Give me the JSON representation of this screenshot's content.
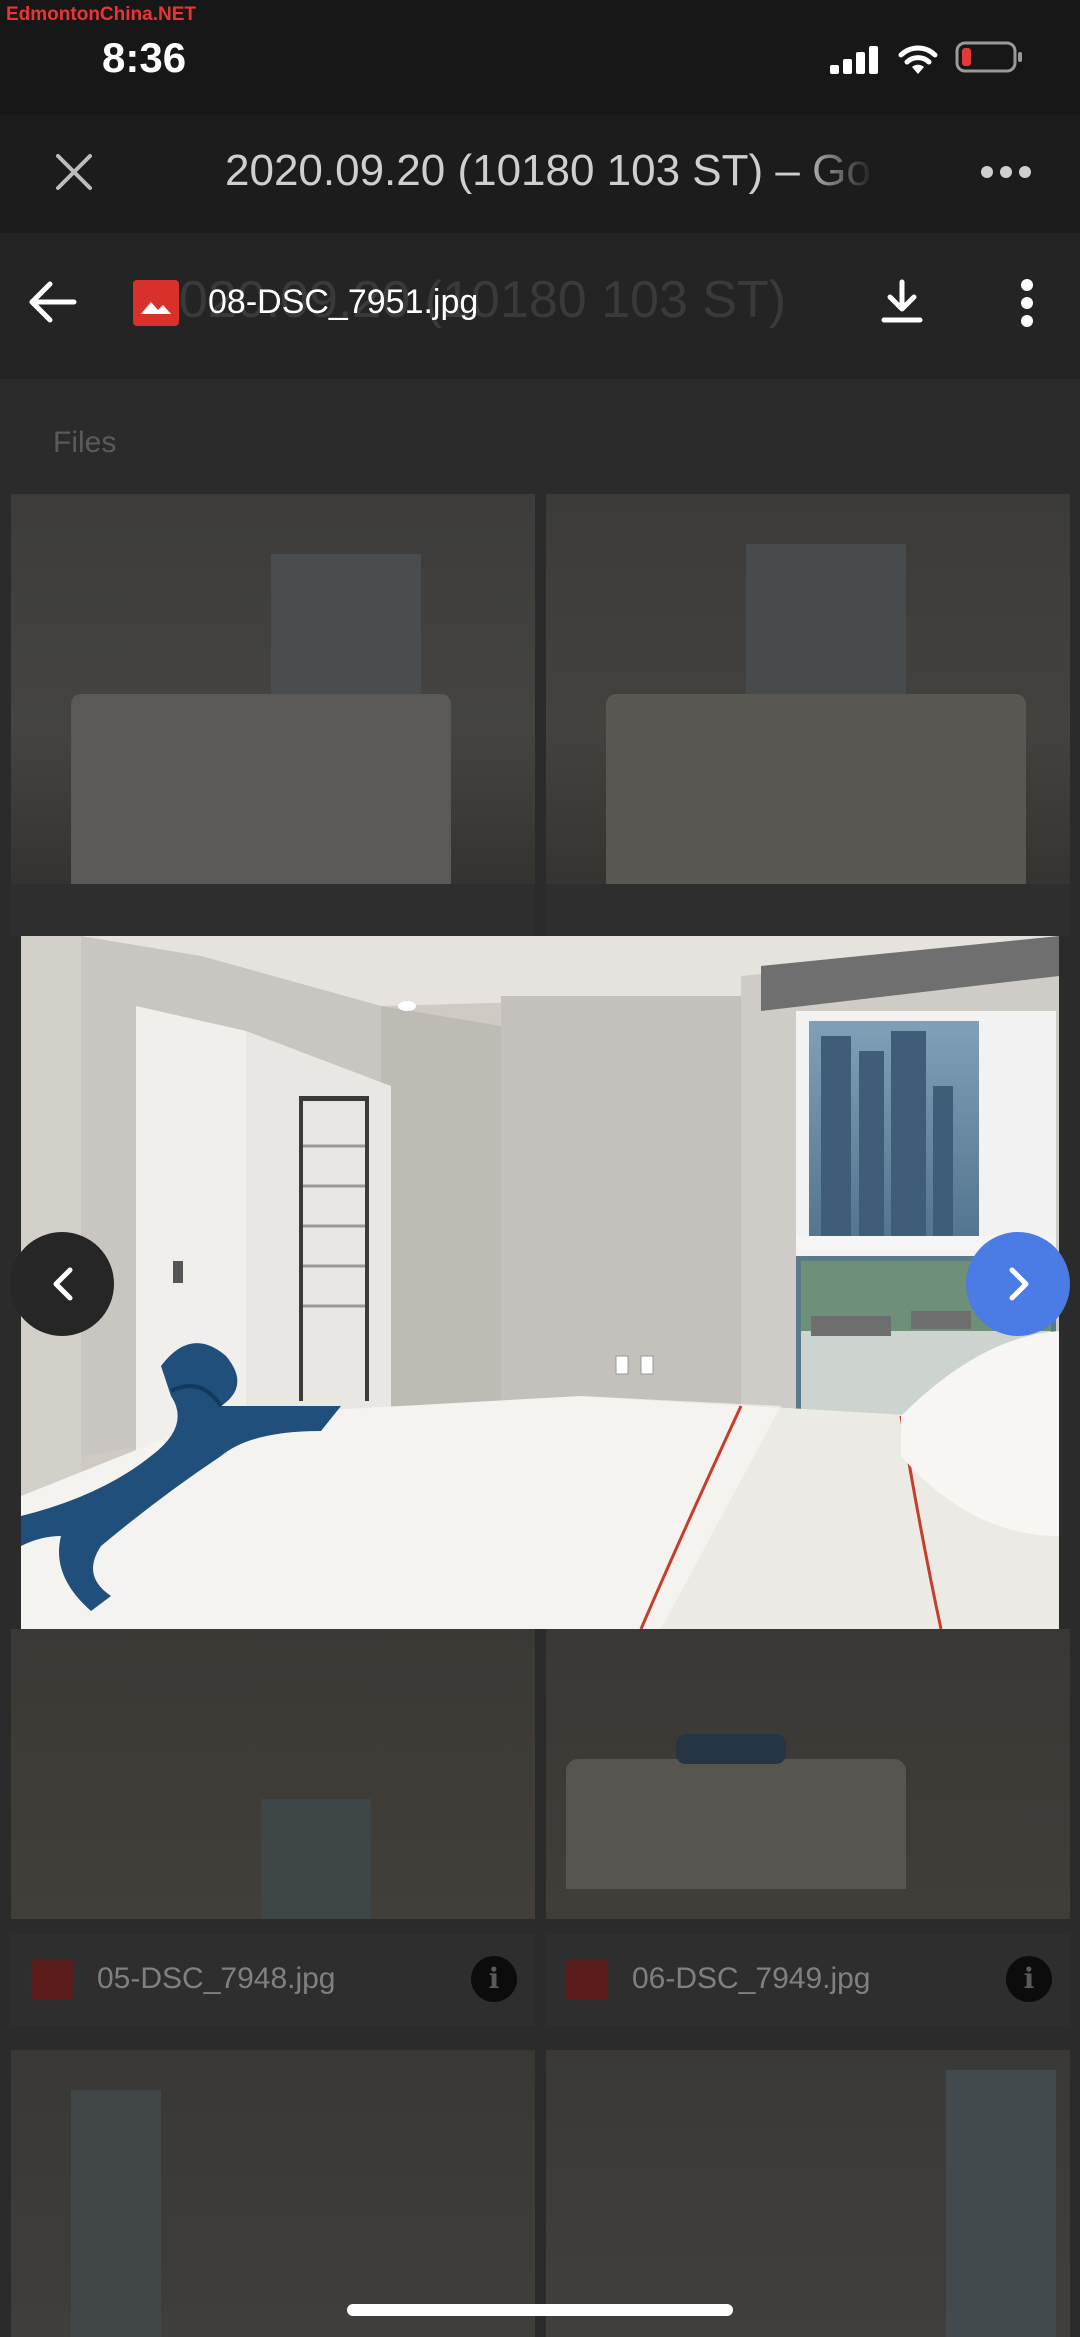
{
  "watermark": "EdmontonChina.NET",
  "status_bar": {
    "time": "8:36",
    "battery_color": "#e53935"
  },
  "browser": {
    "title": "2020.09.20 (10180 103 ST) – Go"
  },
  "viewer": {
    "background_title": "2020.09.20 (10180 103 ST)",
    "file_name": "08-DSC_7951.jpg"
  },
  "grid": {
    "section_label": "Files",
    "captions": [
      "05-DSC_7948.jpg",
      "06-DSC_7949.jpg"
    ],
    "info_glyph": "i"
  },
  "icons": {
    "close": "close-icon",
    "more": "more-horizontal-icon",
    "back": "arrow-left-icon",
    "file": "image-file-icon",
    "download": "download-icon",
    "kebab": "more-vertical-icon",
    "prev": "chevron-left-icon",
    "next": "chevron-right-icon"
  },
  "colors": {
    "accent": "#4b7be5",
    "file_icon": "#d9302c"
  }
}
